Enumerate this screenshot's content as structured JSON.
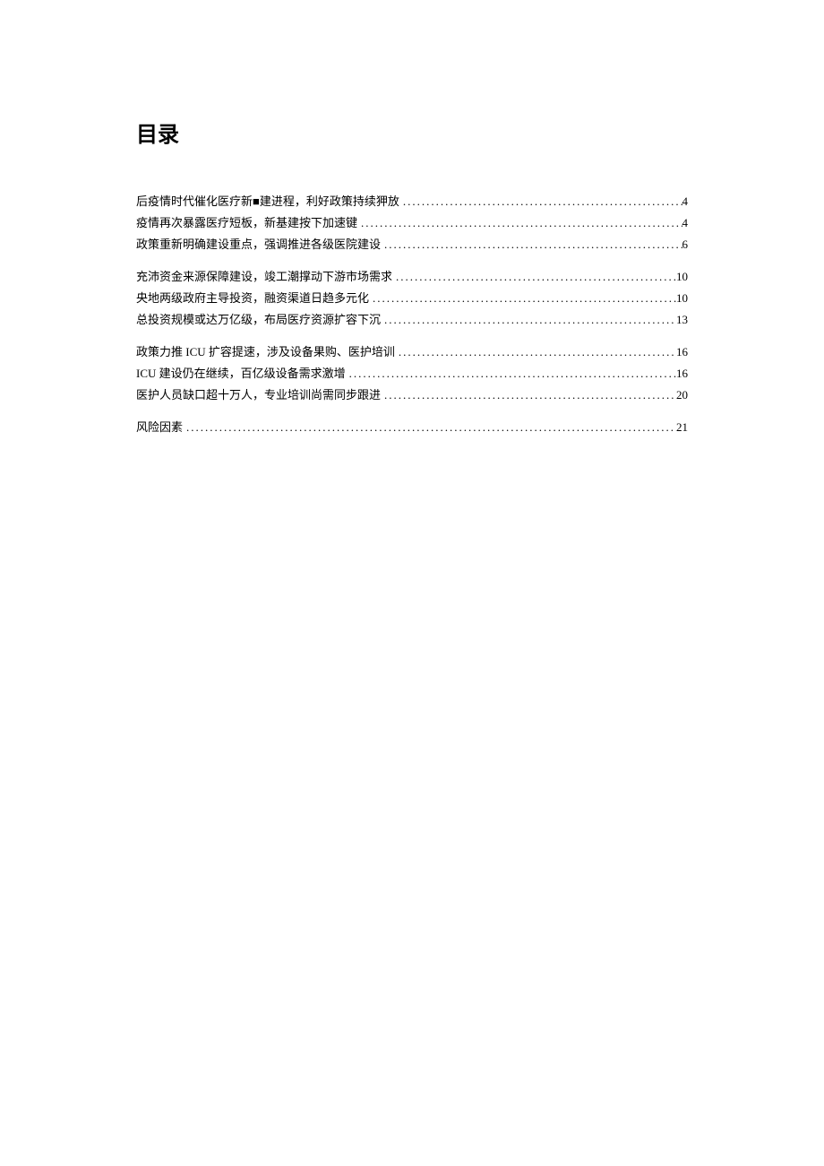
{
  "title": "目录",
  "sections": [
    [
      {
        "label": "后疫情时代催化医疗新■建进程，利好政策持续狎放",
        "page": "4"
      },
      {
        "label": "疫情再次暴露医疗短板，新基建按下加速键",
        "page": "4"
      },
      {
        "label": "政策重新明确建设重点，强调推进各级医院建设",
        "page": "6"
      }
    ],
    [
      {
        "label": "充沛资金来源保障建设，竣工潮撑动下游市场需求",
        "page": "10"
      },
      {
        "label": "央地两级政府主导投资，融资渠道日趋多元化",
        "page": "10"
      },
      {
        "label": "总投资规模或达万亿级，布局医疗资源扩容下沉",
        "page": "13"
      }
    ],
    [
      {
        "label": "政策力推 ICU 扩容提速，涉及设备果购、医护培训",
        "page": "16"
      },
      {
        "label": "ICU 建设仍在继续，百亿级设备需求激增",
        "page": "16"
      },
      {
        "label": "医护人员缺口超十万人，专业培训尚需同步跟进",
        "page": "20"
      }
    ],
    [
      {
        "label": "风险因素",
        "page": "21"
      }
    ]
  ]
}
